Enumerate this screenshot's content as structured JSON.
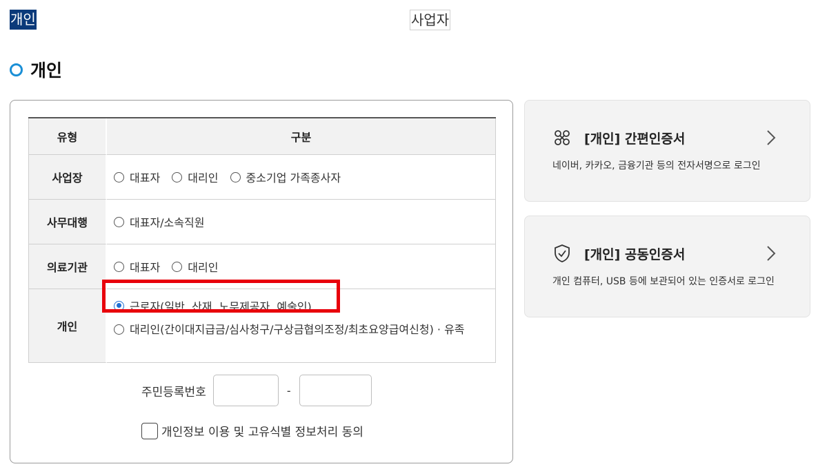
{
  "tabs": {
    "individual": "개인",
    "business": "사업자"
  },
  "section_title": "개인",
  "table": {
    "headers": [
      "유형",
      "구분"
    ],
    "rows": [
      {
        "type": "사업장",
        "options": [
          "대표자",
          "대리인",
          "중소기업 가족종사자"
        ]
      },
      {
        "type": "사무대행",
        "options": [
          "대표자/소속직원"
        ]
      },
      {
        "type": "의료기관",
        "options": [
          "대표자",
          "대리인"
        ]
      },
      {
        "type": "개인",
        "options": [
          "근로자(일반, 산재, 노무제공자, 예술인)",
          "대리인(간이대지급금/심사청구/구상금협의조정/최초요양급여신청) · 유족"
        ],
        "selected": 0
      }
    ]
  },
  "id_field": {
    "label": "주민등록번호",
    "dash": "-",
    "part1": "",
    "part2": ""
  },
  "consent": {
    "label": "개인정보 이용 및 고유식별 정보처리 동의",
    "checked": false
  },
  "cards": [
    {
      "title": "[개인] 간편인증서",
      "desc": "네이버, 카카오, 금융기관 등의 전자서명으로 로그인",
      "icon": "simple-cert-icon"
    },
    {
      "title": "[개인] 공동인증서",
      "desc": "개인 컴퓨터, USB 등에 보관되어 있는 인증서로 로그인",
      "icon": "shield-check-icon"
    }
  ],
  "colors": {
    "accent": "#1f6fd4",
    "tab_active": "#0b3a7a",
    "highlight": "#e8000b",
    "bullet": "#1a8fd6"
  }
}
